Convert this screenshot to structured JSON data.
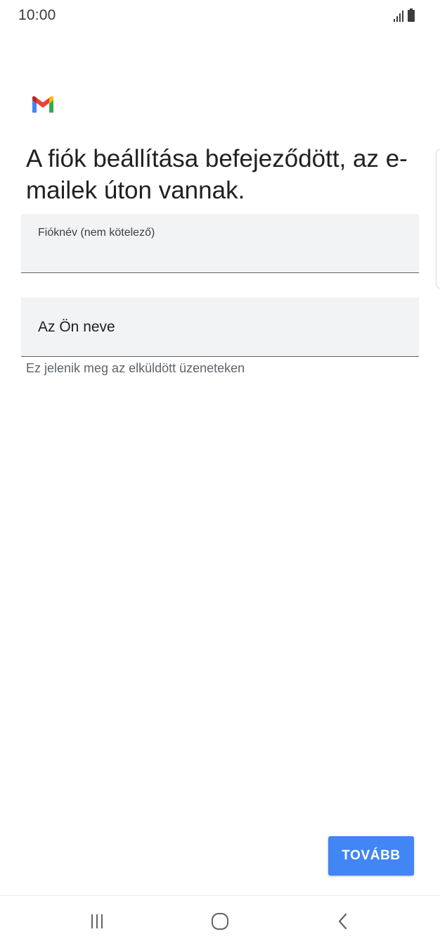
{
  "status_bar": {
    "time": "10:00",
    "icons": [
      "signal-icon",
      "battery-icon"
    ]
  },
  "app": {
    "logo": "gmail-logo"
  },
  "main": {
    "title": "A fiók beállítása befejeződött, az e-mailek úton vannak.",
    "account_name_field": {
      "label": "Fióknév (nem kötelező)",
      "value": ""
    },
    "your_name_field": {
      "value": "Az Ön neve"
    },
    "helper_text": "Ez jelenik meg az elküldött üzeneteken",
    "next_label": "TOVÁBB"
  },
  "nav_bar": {
    "buttons": [
      "recents-icon",
      "home-icon",
      "back-icon"
    ]
  },
  "colors": {
    "accent": "#4285f4",
    "field_background": "#f1f3f4",
    "text_primary": "#202124",
    "text_secondary": "#5f6368"
  }
}
